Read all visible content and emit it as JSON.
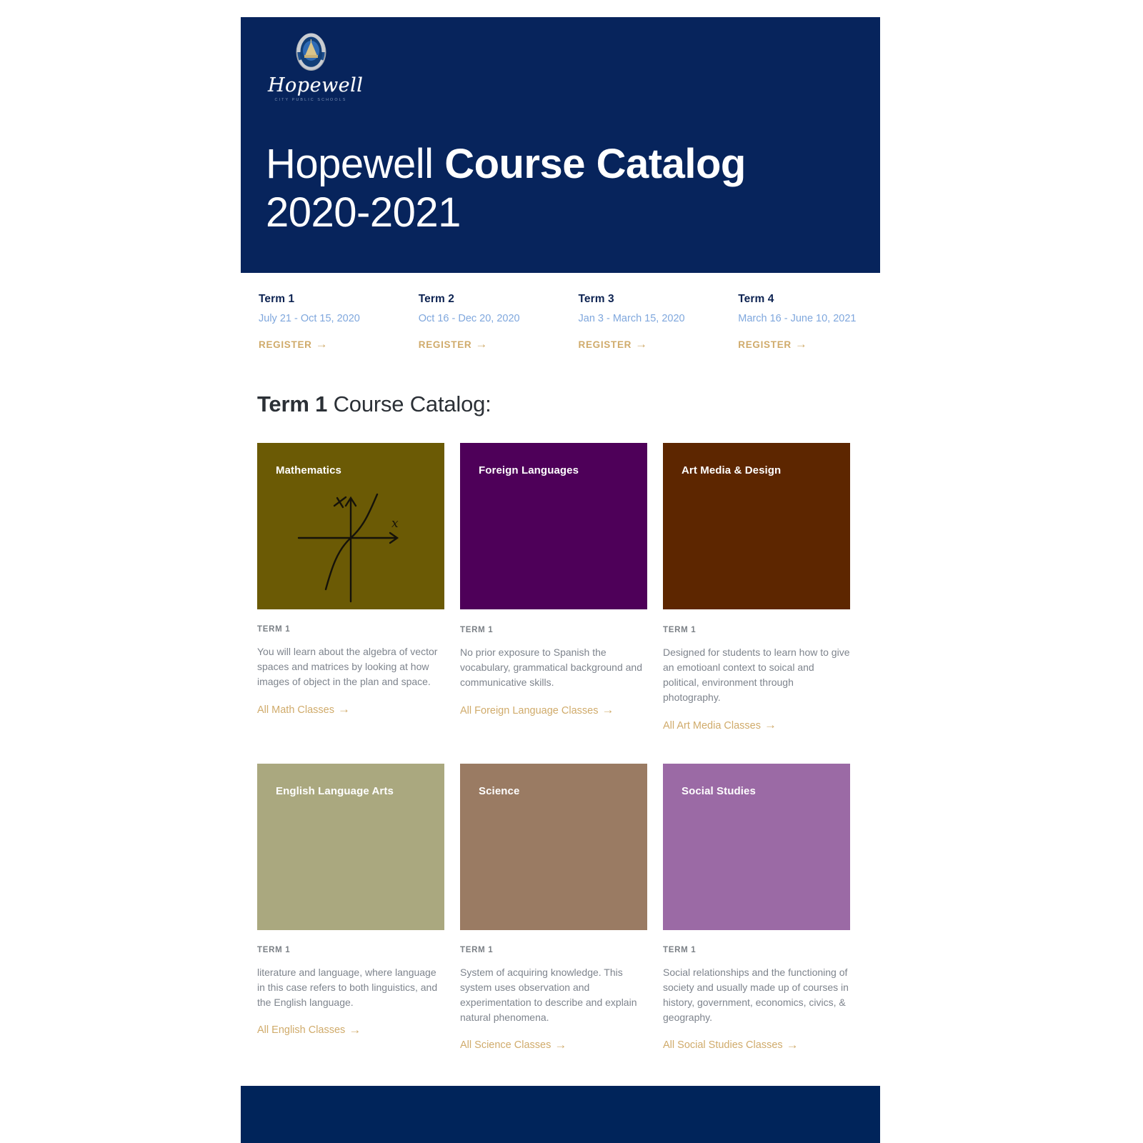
{
  "hero": {
    "logo": {
      "seal_alt": "hopewell-city-public-schools-seal",
      "script": "Hopewell",
      "subtitle": "CITY PUBLIC SCHOOLS"
    },
    "title_regular": "Hopewell ",
    "title_bold": "Course Catalog",
    "title_line2": "2020-2021",
    "bg_color": "#07245c"
  },
  "terms": [
    {
      "name": "Term 1",
      "dates": "July 21 - Oct 15, 2020",
      "register": "REGISTER",
      "arrow": "→"
    },
    {
      "name": "Term 2",
      "dates": "Oct 16 - Dec 20, 2020",
      "register": "REGISTER",
      "arrow": "→"
    },
    {
      "name": "Term 3",
      "dates": "Jan 3 - March 15, 2020",
      "register": "REGISTER",
      "arrow": "→"
    },
    {
      "name": "Term 4",
      "dates": "March 16 - June 10, 2021",
      "register": "REGISTER",
      "arrow": "→"
    }
  ],
  "section": {
    "heading_bold": "Term 1",
    "heading_regular": " Course Catalog:"
  },
  "cards": [
    {
      "title": "Mathematics",
      "term": "TERM 1",
      "description": "You will learn about the algebra of vector spaces and matrices by looking at how images of object in the plan and space.",
      "link": "All Math Classes",
      "arrow": "→",
      "color": "#6b5a05",
      "image": "hand-drawn-cubic-graph"
    },
    {
      "title": "Foreign Languages",
      "term": "TERM 1",
      "description": "No prior exposure to Spanish the vocabulary, grammatical background and communicative skills.",
      "link": "All Foreign Language Classes",
      "arrow": "→",
      "color": "#4e0059",
      "image": ""
    },
    {
      "title": "Art Media & Design",
      "term": "TERM 1",
      "description": "Designed for students to learn how to give an emotioanl context to soical and political, environment through photography.",
      "link": "All Art Media Classes",
      "arrow": "→",
      "color": "#5d2600",
      "image": ""
    },
    {
      "title": "English Language Arts",
      "term": "TERM 1",
      "description": "literature and language, where language in this case refers to both linguistics, and the English language.",
      "link": "All English Classes",
      "arrow": "→",
      "color": "#aaa87f",
      "image": ""
    },
    {
      "title": "Science",
      "term": "TERM 1",
      "description": "System of acquiring knowledge. This system uses observation and experimentation to describe and explain natural phenomena.",
      "link": "All Science Classes",
      "arrow": "→",
      "color": "#9a7b63",
      "image": ""
    },
    {
      "title": "Social Studies",
      "term": "TERM 1",
      "description": "Social relationships and the functioning of society and usually made up of courses in history, government, economics, civics, & geography.",
      "link": "All Social Studies Classes",
      "arrow": "→",
      "color": "#9b6aa5",
      "image": ""
    }
  ],
  "footer": {
    "bg_color": "#00245a"
  },
  "colors": {
    "navy": "#07245c",
    "gold": "#d0ab6b",
    "light_blue": "#7fa7dd",
    "body_gray": "#7e848d"
  }
}
